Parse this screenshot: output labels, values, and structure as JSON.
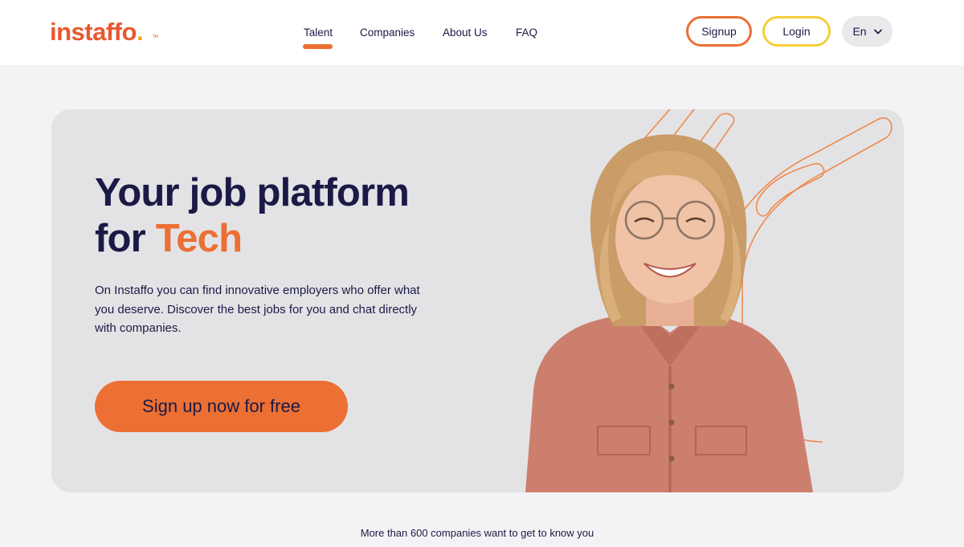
{
  "brand": {
    "logo_text": "instaffo",
    "logo_dot": ".",
    "logo_tm": "TM",
    "accent_color": "#ec6f33",
    "login_color": "#f4cd3a",
    "text_color": "#1b1a46"
  },
  "nav": {
    "items": [
      {
        "label": "Talent",
        "active": true
      },
      {
        "label": "Companies",
        "active": false
      },
      {
        "label": "About Us",
        "active": false
      },
      {
        "label": "FAQ",
        "active": false
      }
    ]
  },
  "header": {
    "signup_label": "Signup",
    "login_label": "Login",
    "language": "En",
    "language_icon": "chevron-down-icon"
  },
  "hero": {
    "title_line1": "Your job platform",
    "title_line2_prefix": "for ",
    "title_line2_accent": "Tech",
    "description": "On Instaffo you can find innovative employers who offer what you deserve. Discover the best jobs for you and chat directly with companies.",
    "cta_label": "Sign up now for free"
  },
  "footer_note": "More than 600 companies want to get to know you"
}
